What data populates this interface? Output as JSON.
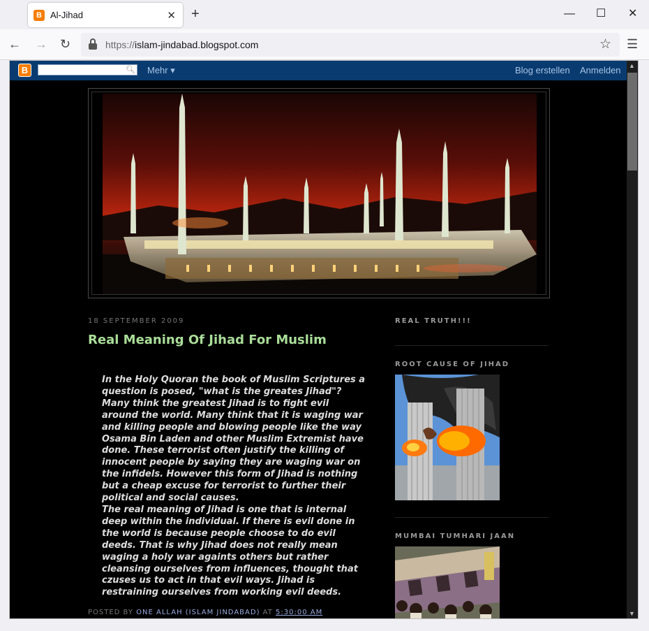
{
  "browser": {
    "tab_title": "Al-Jihad",
    "url_scheme": "https://",
    "url_host": "islam-jindabad.blogspot.com"
  },
  "blogger_nav": {
    "more_label": "Mehr",
    "create_blog": "Blog erstellen",
    "sign_in": "Anmelden"
  },
  "post": {
    "date": "18 SEPTEMBER 2009",
    "title": "Real Meaning Of Jihad For Muslim",
    "paragraph_1": "In the Holy Quoran the book of Muslim Scriptures a question is posed, \"what is the greates Jihad\"? Many think the greatest Jihad is to fight evil around the world. Many think that it is waging war and killing people and blowing people like the way Osama Bin Laden and other Muslim Extremist have done. These terrorist often justify the killing of innocent people by saying they are waging war on the infidels. However this form of Jihad is nothing but a cheap excuse for terrorist to further their political and social causes.",
    "paragraph_2": "The real meaning of Jihad is one that is internal deep within the individual. If there is evil done in the world is because people choose to do evil deeds. That is why Jihad does not really mean waging a holy war againts others but rather cleansing ourselves from influences, thought that czuses us to act in that evil ways. Jihad is restraining ourselves from working evil deeds.",
    "footer_posted_by": "POSTED BY",
    "footer_author": "ONE ALLAH (ISLAM JINDABAD)",
    "footer_at": "AT",
    "footer_time": "5:30:00 AM"
  },
  "sidebar": {
    "heading_1": "REAL TRUTH!!!",
    "heading_2": "ROOT CAUSE OF JIHAD",
    "heading_3": "MUMBAI TUMHARI JAAN"
  },
  "colors": {
    "blogger_nav_bg": "#093b70",
    "page_bg": "#000000",
    "title_green": "#aadd99",
    "link_blue": "#99aadd",
    "blogger_orange": "#f57d00"
  }
}
